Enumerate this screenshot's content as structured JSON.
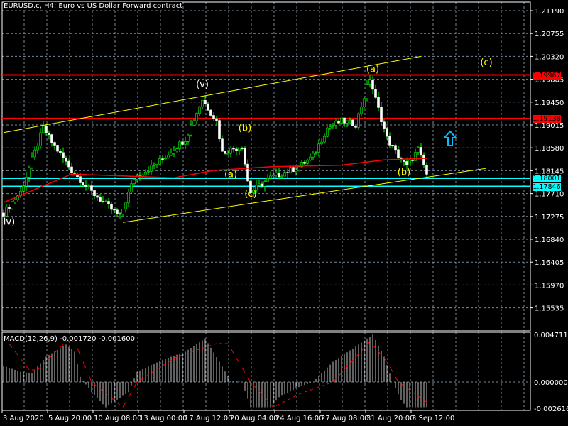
{
  "window": {
    "title": "EURUSD.c, H4:  Euro vs US Dollar Forward contract"
  },
  "colors": {
    "bg": "#000000",
    "grid": "#778899",
    "bull": "#00ff00",
    "ma": "#ff0000",
    "trend": "#ffff00",
    "resistance": "#ff0000",
    "support": "#00ffff",
    "histogram": "#c0c0c0",
    "signal": "#ff0000"
  },
  "price_axis": {
    "ticks": [
      "1.21190",
      "1.20755",
      "1.20320",
      "1.19885",
      "1.19450",
      "1.19015",
      "1.18580",
      "1.18145",
      "1.17710",
      "1.17275",
      "1.16840",
      "1.16405",
      "1.15970",
      "1.15535"
    ]
  },
  "levels": [
    {
      "label": "1.19967",
      "price": 1.19967,
      "color": "#ff0000"
    },
    {
      "label": "1.19138",
      "price": 1.19138,
      "color": "#ff0000"
    },
    {
      "label": "1.18001",
      "price": 1.18001,
      "color": "#00ffff"
    },
    {
      "label": "1.17846",
      "price": 1.17846,
      "color": "#00ffff"
    }
  ],
  "wave_labels": [
    {
      "text": "(v)",
      "color": "#ffffff",
      "bar": 70,
      "price": 1.1973
    },
    {
      "text": "(b)",
      "color": "#ffff00",
      "bar": 85,
      "price": 1.189
    },
    {
      "text": "(a)",
      "color": "#ffff00",
      "bar": 80,
      "price": 1.1802
    },
    {
      "text": "(c)",
      "color": "#ffff00",
      "bar": 87,
      "price": 1.1765
    },
    {
      "text": "(a)",
      "color": "#ffff00",
      "bar": 130,
      "price": 1.2002
    },
    {
      "text": "(b)",
      "color": "#ffff00",
      "bar": 141,
      "price": 1.1806
    },
    {
      "text": "(c)",
      "color": "#ffff00",
      "bar": 170,
      "price": 1.2015
    },
    {
      "text": "iv)",
      "color": "#ffffff",
      "bar": 2,
      "price": 1.1712
    }
  ],
  "macd": {
    "label": "MACD(12,26,9) -0.001720 -0.001600",
    "ticks": [
      "0.004711",
      "0.000000",
      "-0.002616"
    ]
  },
  "time_axis": [
    "3 Aug 2020",
    "5 Aug 20:00",
    "10 Aug 08:00",
    "13 Aug 00:00",
    "17 Aug 12:00",
    "20 Aug 04:00",
    "24 Aug 16:00",
    "27 Aug 08:00",
    "31 Aug 20:00",
    "3 Sep 12:00"
  ],
  "chart_data": {
    "type": "candlestick",
    "symbol": "EURUSD.c",
    "timeframe": "H4",
    "ylim": [
      1.151,
      1.215
    ],
    "bars": 150,
    "close_path": [
      [
        0,
        1.1734
      ],
      [
        6,
        1.1774
      ],
      [
        14,
        1.1896
      ],
      [
        17,
        1.1869
      ],
      [
        24,
        1.1815
      ],
      [
        31,
        1.1774
      ],
      [
        41,
        1.1727
      ],
      [
        46,
        1.1801
      ],
      [
        54,
        1.1828
      ],
      [
        64,
        1.1875
      ],
      [
        70,
        1.195
      ],
      [
        75,
        1.1909
      ],
      [
        77,
        1.1849
      ],
      [
        84,
        1.1862
      ],
      [
        86,
        1.1795
      ],
      [
        87,
        1.1774
      ],
      [
        94,
        1.1801
      ],
      [
        104,
        1.1822
      ],
      [
        109,
        1.1842
      ],
      [
        114,
        1.1896
      ],
      [
        119,
        1.1909
      ],
      [
        124,
        1.1903
      ],
      [
        129,
        1.199
      ],
      [
        131,
        1.195
      ],
      [
        135,
        1.1876
      ],
      [
        139,
        1.1842
      ],
      [
        142,
        1.1822
      ],
      [
        146,
        1.1855
      ],
      [
        149,
        1.1808
      ]
    ],
    "ma_path": [
      [
        0,
        1.1754
      ],
      [
        24,
        1.1808
      ],
      [
        60,
        1.1801
      ],
      [
        74,
        1.1815
      ],
      [
        94,
        1.1822
      ],
      [
        119,
        1.1825
      ],
      [
        134,
        1.1835
      ],
      [
        149,
        1.1838
      ]
    ],
    "trendlines": [
      {
        "from": [
          0,
          1.1887
        ],
        "to": [
          147,
          1.2032
        ]
      },
      {
        "from": [
          42,
          1.1716
        ],
        "to": [
          170,
          1.1819
        ]
      }
    ],
    "macd_hist": [
      [
        0,
        0.0016
      ],
      [
        6,
        0.001
      ],
      [
        10,
        0.0009
      ],
      [
        15,
        0.0025
      ],
      [
        22,
        0.0037
      ],
      [
        25,
        0.003
      ],
      [
        27,
        0.0005
      ],
      [
        31,
        -0.001
      ],
      [
        36,
        -0.0025
      ],
      [
        44,
        -0.001
      ],
      [
        47,
        0.001
      ],
      [
        56,
        0.0022
      ],
      [
        64,
        0.003
      ],
      [
        71,
        0.0043
      ],
      [
        76,
        0.002
      ],
      [
        80,
        0.0001
      ],
      [
        84,
        0.0
      ],
      [
        87,
        -0.0025
      ],
      [
        94,
        -0.0025
      ],
      [
        97,
        -0.0015
      ],
      [
        104,
        -0.0005
      ],
      [
        109,
        0.0
      ],
      [
        116,
        0.002
      ],
      [
        124,
        0.0035
      ],
      [
        130,
        0.0047
      ],
      [
        134,
        0.0025
      ],
      [
        137,
        0.0
      ],
      [
        140,
        -0.0018
      ],
      [
        142,
        -0.0025
      ],
      [
        149,
        -0.0025
      ]
    ],
    "macd_signal": [
      [
        0,
        0.0045
      ],
      [
        9,
        0.0012
      ],
      [
        12,
        0.0012
      ],
      [
        22,
        0.004
      ],
      [
        25,
        0.004
      ],
      [
        31,
        0.0
      ],
      [
        42,
        -0.0025
      ],
      [
        47,
        0.0
      ],
      [
        61,
        0.0025
      ],
      [
        75,
        0.0038
      ],
      [
        79,
        0.0038
      ],
      [
        87,
        0.0
      ],
      [
        95,
        -0.0025
      ],
      [
        104,
        -0.0012
      ],
      [
        116,
        0.0
      ],
      [
        129,
        0.004
      ],
      [
        135,
        0.002
      ],
      [
        139,
        0.0
      ],
      [
        149,
        -0.002
      ]
    ],
    "macd_ylim": [
      -0.002616,
      0.004711
    ]
  }
}
